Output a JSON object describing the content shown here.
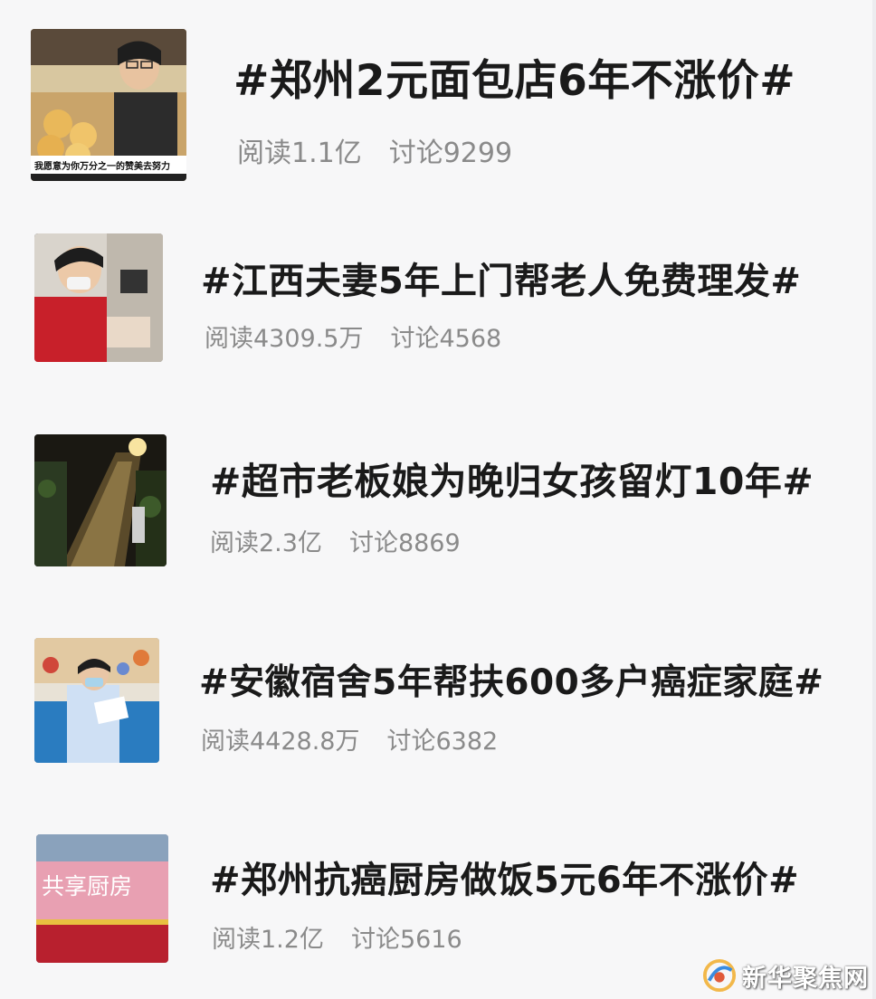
{
  "topics": [
    {
      "title": "#郑州2元面包店6年不涨价#",
      "reads": "阅读1.1亿",
      "discussions": "讨论9299",
      "thumb_caption": "我愿意为你万分之一的赞美去努力"
    },
    {
      "title": "#江西夫妻5年上门帮老人免费理发#",
      "reads": "阅读4309.5万",
      "discussions": "讨论4568"
    },
    {
      "title": "#超市老板娘为晚归女孩留灯10年#",
      "reads": "阅读2.3亿",
      "discussions": "讨论8869"
    },
    {
      "title": "#安徽宿舍5年帮扶600多户癌症家庭#",
      "reads": "阅读4428.8万",
      "discussions": "讨论6382"
    },
    {
      "title": "#郑州抗癌厨房做饭5元6年不涨价#",
      "reads": "阅读1.2亿",
      "discussions": "讨论5616",
      "thumb_sign": "共享厨房"
    }
  ],
  "watermark": {
    "text": "新华聚焦网"
  },
  "colors": {
    "title": "#1a1a1a",
    "meta": "#8a8a8a",
    "background": "#f7f7f8"
  }
}
